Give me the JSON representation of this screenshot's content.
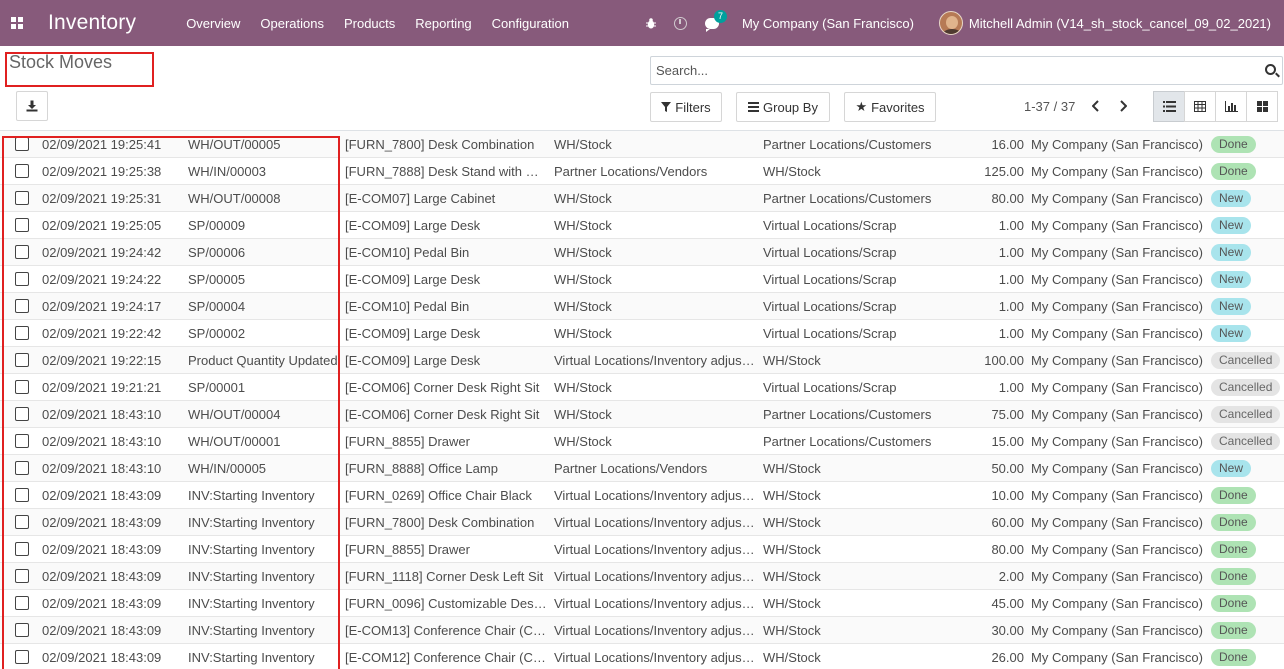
{
  "navbar": {
    "brand": "Inventory",
    "menu": [
      "Overview",
      "Operations",
      "Products",
      "Reporting",
      "Configuration"
    ],
    "messages_count": "7",
    "company": "My Company (San Francisco)",
    "user": "Mitchell Admin (V14_sh_stock_cancel_09_02_2021)",
    "accent_color": "#875a7b"
  },
  "control_panel": {
    "title": "Stock Moves",
    "search_placeholder": "Search...",
    "filters_label": "Filters",
    "groupby_label": "Group By",
    "favorites_label": "Favorites",
    "pager": "1-37 / 37"
  },
  "icons": {
    "apps": "apps-grid-icon",
    "download": "download-icon",
    "search": "search-icon",
    "filter": "filter-icon",
    "groupby": "bars-icon",
    "favorites": "star-icon",
    "views": [
      "list-view-icon",
      "table-view-icon",
      "graph-view-icon",
      "kanban-view-icon"
    ]
  },
  "rows": [
    {
      "date": "02/09/2021 19:25:41",
      "ref": "WH/OUT/00005",
      "product": "[FURN_7800] Desk Combination",
      "from": "WH/Stock",
      "to": "Partner Locations/Customers",
      "qty": "16.00",
      "company": "My Company (San Francisco)",
      "status": "Done",
      "status_class": "done"
    },
    {
      "date": "02/09/2021 19:25:38",
      "ref": "WH/IN/00003",
      "product": "[FURN_7888] Desk Stand with …",
      "from": "Partner Locations/Vendors",
      "to": "WH/Stock",
      "qty": "125.00",
      "company": "My Company (San Francisco)",
      "status": "Done",
      "status_class": "done"
    },
    {
      "date": "02/09/2021 19:25:31",
      "ref": "WH/OUT/00008",
      "product": "[E-COM07] Large Cabinet",
      "from": "WH/Stock",
      "to": "Partner Locations/Customers",
      "qty": "80.00",
      "company": "My Company (San Francisco)",
      "status": "New",
      "status_class": "new"
    },
    {
      "date": "02/09/2021 19:25:05",
      "ref": "SP/00009",
      "product": "[E-COM09] Large Desk",
      "from": "WH/Stock",
      "to": "Virtual Locations/Scrap",
      "qty": "1.00",
      "company": "My Company (San Francisco)",
      "status": "New",
      "status_class": "new"
    },
    {
      "date": "02/09/2021 19:24:42",
      "ref": "SP/00006",
      "product": "[E-COM10] Pedal Bin",
      "from": "WH/Stock",
      "to": "Virtual Locations/Scrap",
      "qty": "1.00",
      "company": "My Company (San Francisco)",
      "status": "New",
      "status_class": "new"
    },
    {
      "date": "02/09/2021 19:24:22",
      "ref": "SP/00005",
      "product": "[E-COM09] Large Desk",
      "from": "WH/Stock",
      "to": "Virtual Locations/Scrap",
      "qty": "1.00",
      "company": "My Company (San Francisco)",
      "status": "New",
      "status_class": "new"
    },
    {
      "date": "02/09/2021 19:24:17",
      "ref": "SP/00004",
      "product": "[E-COM10] Pedal Bin",
      "from": "WH/Stock",
      "to": "Virtual Locations/Scrap",
      "qty": "1.00",
      "company": "My Company (San Francisco)",
      "status": "New",
      "status_class": "new"
    },
    {
      "date": "02/09/2021 19:22:42",
      "ref": "SP/00002",
      "product": "[E-COM09] Large Desk",
      "from": "WH/Stock",
      "to": "Virtual Locations/Scrap",
      "qty": "1.00",
      "company": "My Company (San Francisco)",
      "status": "New",
      "status_class": "new"
    },
    {
      "date": "02/09/2021 19:22:15",
      "ref": "Product Quantity Updated",
      "product": "[E-COM09] Large Desk",
      "from": "Virtual Locations/Inventory adjus…",
      "to": "WH/Stock",
      "qty": "100.00",
      "company": "My Company (San Francisco)",
      "status": "Cancelled",
      "status_class": "cancelled"
    },
    {
      "date": "02/09/2021 19:21:21",
      "ref": "SP/00001",
      "product": "[E-COM06] Corner Desk Right Sit",
      "from": "WH/Stock",
      "to": "Virtual Locations/Scrap",
      "qty": "1.00",
      "company": "My Company (San Francisco)",
      "status": "Cancelled",
      "status_class": "cancelled"
    },
    {
      "date": "02/09/2021 18:43:10",
      "ref": "WH/OUT/00004",
      "product": "[E-COM06] Corner Desk Right Sit",
      "from": "WH/Stock",
      "to": "Partner Locations/Customers",
      "qty": "75.00",
      "company": "My Company (San Francisco)",
      "status": "Cancelled",
      "status_class": "cancelled"
    },
    {
      "date": "02/09/2021 18:43:10",
      "ref": "WH/OUT/00001",
      "product": "[FURN_8855] Drawer",
      "from": "WH/Stock",
      "to": "Partner Locations/Customers",
      "qty": "15.00",
      "company": "My Company (San Francisco)",
      "status": "Cancelled",
      "status_class": "cancelled"
    },
    {
      "date": "02/09/2021 18:43:10",
      "ref": "WH/IN/00005",
      "product": "[FURN_8888] Office Lamp",
      "from": "Partner Locations/Vendors",
      "to": "WH/Stock",
      "qty": "50.00",
      "company": "My Company (San Francisco)",
      "status": "New",
      "status_class": "new"
    },
    {
      "date": "02/09/2021 18:43:09",
      "ref": "INV:Starting Inventory",
      "product": "[FURN_0269] Office Chair Black",
      "from": "Virtual Locations/Inventory adjus…",
      "to": "WH/Stock",
      "qty": "10.00",
      "company": "My Company (San Francisco)",
      "status": "Done",
      "status_class": "done"
    },
    {
      "date": "02/09/2021 18:43:09",
      "ref": "INV:Starting Inventory",
      "product": "[FURN_7800] Desk Combination",
      "from": "Virtual Locations/Inventory adjus…",
      "to": "WH/Stock",
      "qty": "60.00",
      "company": "My Company (San Francisco)",
      "status": "Done",
      "status_class": "done"
    },
    {
      "date": "02/09/2021 18:43:09",
      "ref": "INV:Starting Inventory",
      "product": "[FURN_8855] Drawer",
      "from": "Virtual Locations/Inventory adjus…",
      "to": "WH/Stock",
      "qty": "80.00",
      "company": "My Company (San Francisco)",
      "status": "Done",
      "status_class": "done"
    },
    {
      "date": "02/09/2021 18:43:09",
      "ref": "INV:Starting Inventory",
      "product": "[FURN_1118] Corner Desk Left Sit",
      "from": "Virtual Locations/Inventory adjus…",
      "to": "WH/Stock",
      "qty": "2.00",
      "company": "My Company (San Francisco)",
      "status": "Done",
      "status_class": "done"
    },
    {
      "date": "02/09/2021 18:43:09",
      "ref": "INV:Starting Inventory",
      "product": "[FURN_0096] Customizable Des…",
      "from": "Virtual Locations/Inventory adjus…",
      "to": "WH/Stock",
      "qty": "45.00",
      "company": "My Company (San Francisco)",
      "status": "Done",
      "status_class": "done"
    },
    {
      "date": "02/09/2021 18:43:09",
      "ref": "INV:Starting Inventory",
      "product": "[E-COM13] Conference Chair (C…",
      "from": "Virtual Locations/Inventory adjus…",
      "to": "WH/Stock",
      "qty": "30.00",
      "company": "My Company (San Francisco)",
      "status": "Done",
      "status_class": "done"
    },
    {
      "date": "02/09/2021 18:43:09",
      "ref": "INV:Starting Inventory",
      "product": "[E-COM12] Conference Chair (C…",
      "from": "Virtual Locations/Inventory adjus…",
      "to": "WH/Stock",
      "qty": "26.00",
      "company": "My Company (San Francisco)",
      "status": "Done",
      "status_class": "done"
    }
  ]
}
